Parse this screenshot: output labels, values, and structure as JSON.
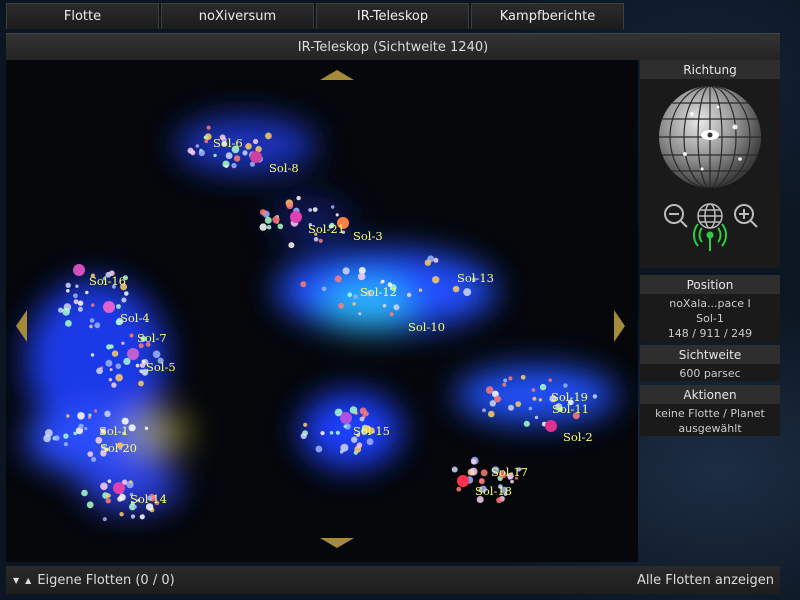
{
  "tabs": [
    "Flotte",
    "noXiversum",
    "IR-Teleskop",
    "Kampfberichte"
  ],
  "title": "IR-Teleskop (Sichtweite 1240)",
  "systems": [
    {
      "name": "Sol-6"
    },
    {
      "name": "Sol-8"
    },
    {
      "name": "Sol-21"
    },
    {
      "name": "Sol-3"
    },
    {
      "name": "Sol-16"
    },
    {
      "name": "Sol-13"
    },
    {
      "name": "Sol-12"
    },
    {
      "name": "Sol-4"
    },
    {
      "name": "Sol-7"
    },
    {
      "name": "Sol-10"
    },
    {
      "name": "Sol-5"
    },
    {
      "name": "Sol-19"
    },
    {
      "name": "Sol-11"
    },
    {
      "name": "Sol-1"
    },
    {
      "name": "Sol-15"
    },
    {
      "name": "Sol-2"
    },
    {
      "name": "Sol-20"
    },
    {
      "name": "Sol-17"
    },
    {
      "name": "Sol-18"
    },
    {
      "name": "Sol-14"
    }
  ],
  "panel": {
    "richtung": "Richtung",
    "position_head": "Position",
    "position_line1": "noXala...pace I",
    "position_line2": "Sol-1",
    "position_line3": "148 / 911 / 249",
    "sichtweite_head": "Sichtweite",
    "sichtweite": "600 parsec",
    "aktionen_head": "Aktionen",
    "aktionen": "keine Flotte / Planet ausgewählt"
  },
  "bottom": {
    "left": "Eigene Flotten (0 / 0)",
    "right": "Alle Flotten anzeigen"
  },
  "colors": {
    "label": "#ffff66",
    "nebula": "#1e4cff",
    "arrow": "#a58a3a",
    "signal": "#2ecc40"
  },
  "icons": [
    "zoom-out-icon",
    "globe-icon",
    "zoom-in-icon",
    "signal-icon"
  ]
}
